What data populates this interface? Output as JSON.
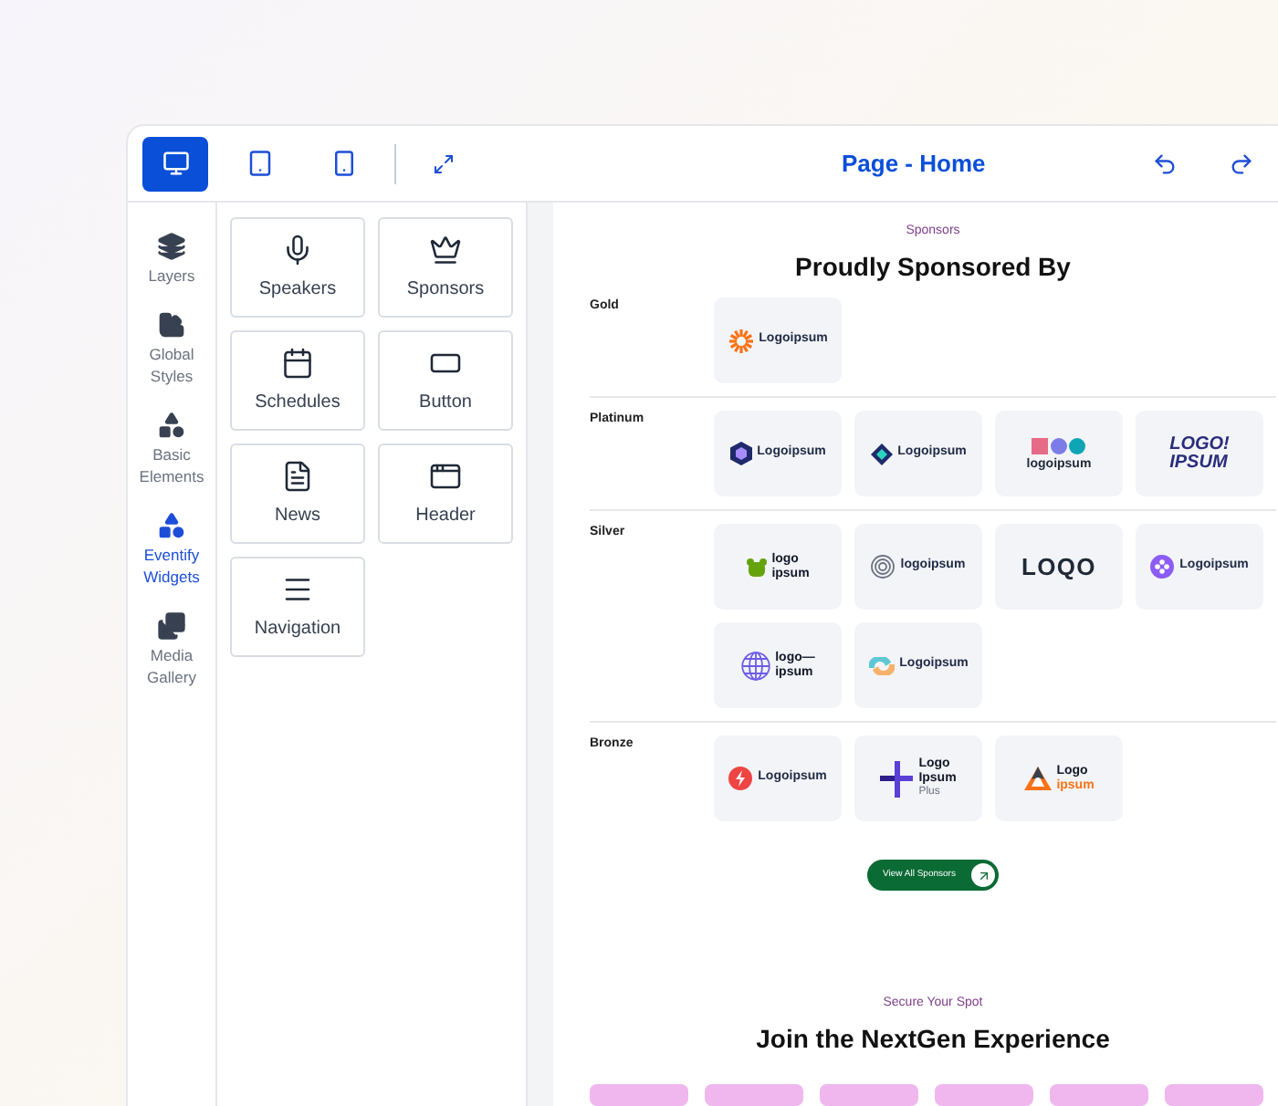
{
  "toolbar": {
    "devices": [
      {
        "kind": "desktop",
        "selected": true
      },
      {
        "kind": "tablet",
        "selected": false
      },
      {
        "kind": "mobile",
        "selected": false
      }
    ],
    "title": "Page - Home"
  },
  "sidebar": {
    "items": [
      {
        "kind": "layers",
        "label": "Layers",
        "selected": false
      },
      {
        "kind": "styles",
        "label": "Global Styles",
        "selected": false
      },
      {
        "kind": "elements",
        "label": "Basic Elements",
        "selected": false
      },
      {
        "kind": "widgets",
        "label": "Eventify Widgets",
        "selected": true
      },
      {
        "kind": "media",
        "label": "Media Gallery",
        "selected": false
      }
    ]
  },
  "widgets": [
    {
      "kind": "mic",
      "label": "Speakers"
    },
    {
      "kind": "crown",
      "label": "Sponsors"
    },
    {
      "kind": "calendar",
      "label": "Schedules"
    },
    {
      "kind": "button",
      "label": "Button"
    },
    {
      "kind": "news",
      "label": "News"
    },
    {
      "kind": "header",
      "label": "Header"
    },
    {
      "kind": "menu",
      "label": "Navigation"
    }
  ],
  "canvas": {
    "eyebrow": "Sponsors",
    "heading": "Proudly Sponsored By",
    "tiers": [
      {
        "name": "Gold",
        "logos": [
          {
            "kind": "sun",
            "lines": [
              "Logoipsum"
            ]
          }
        ]
      },
      {
        "name": "Platinum",
        "logos": [
          {
            "kind": "hex",
            "lines": [
              "Logoipsum"
            ]
          },
          {
            "kind": "diamond",
            "lines": [
              "Logoipsum"
            ]
          },
          {
            "kind": "shapes",
            "lines": [
              "logoipsum"
            ]
          },
          {
            "kind": "none",
            "lines": [
              "LOGO!",
              "IPSUM"
            ]
          }
        ]
      },
      {
        "name": "Silver",
        "logos": [
          {
            "kind": "bear",
            "lines": [
              "logo",
              "ipsum"
            ]
          },
          {
            "kind": "rings",
            "lines": [
              "logoipsum"
            ]
          },
          {
            "kind": "none",
            "lines": [
              "LOQO"
            ]
          },
          {
            "kind": "blob",
            "lines": [
              "Logoipsum"
            ]
          },
          {
            "kind": "globe",
            "lines": [
              "logo—",
              "ipsum"
            ]
          },
          {
            "kind": "swirl",
            "lines": [
              "Logoipsum"
            ]
          }
        ]
      },
      {
        "name": "Bronze",
        "logos": [
          {
            "kind": "bolt",
            "lines": [
              "Logoipsum"
            ]
          },
          {
            "kind": "cross",
            "lines": [
              "Logo",
              "Ipsum",
              "Plus"
            ]
          },
          {
            "kind": "tri",
            "lines": [
              "Logo",
              "ipsum"
            ]
          }
        ]
      }
    ],
    "button": "View All Sponsors",
    "eyebrow2": "Secure Your Spot",
    "heading2": "Join the NextGen Experience",
    "pills": [
      {
        "kind": "pill"
      },
      {
        "kind": "pill"
      },
      {
        "kind": "pill"
      },
      {
        "kind": "pill"
      },
      {
        "kind": "pill"
      },
      {
        "kind": "pill"
      }
    ]
  }
}
